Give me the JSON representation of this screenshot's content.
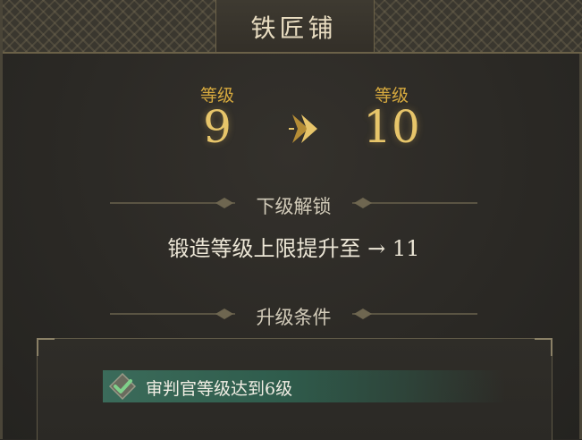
{
  "title": "铁匠铺",
  "level": {
    "current_label": "等级",
    "current_value": "9",
    "next_label": "等级",
    "next_value": "10"
  },
  "next_unlock": {
    "heading": "下级解锁",
    "text": "锻造等级上限提升至 → 11"
  },
  "upgrade_conditions": {
    "heading": "升级条件",
    "items": [
      {
        "text": "审判官等级达到6级",
        "met": true
      }
    ]
  },
  "colors": {
    "gold": "#e7c56a",
    "condition_met": "#3b6b5a"
  }
}
